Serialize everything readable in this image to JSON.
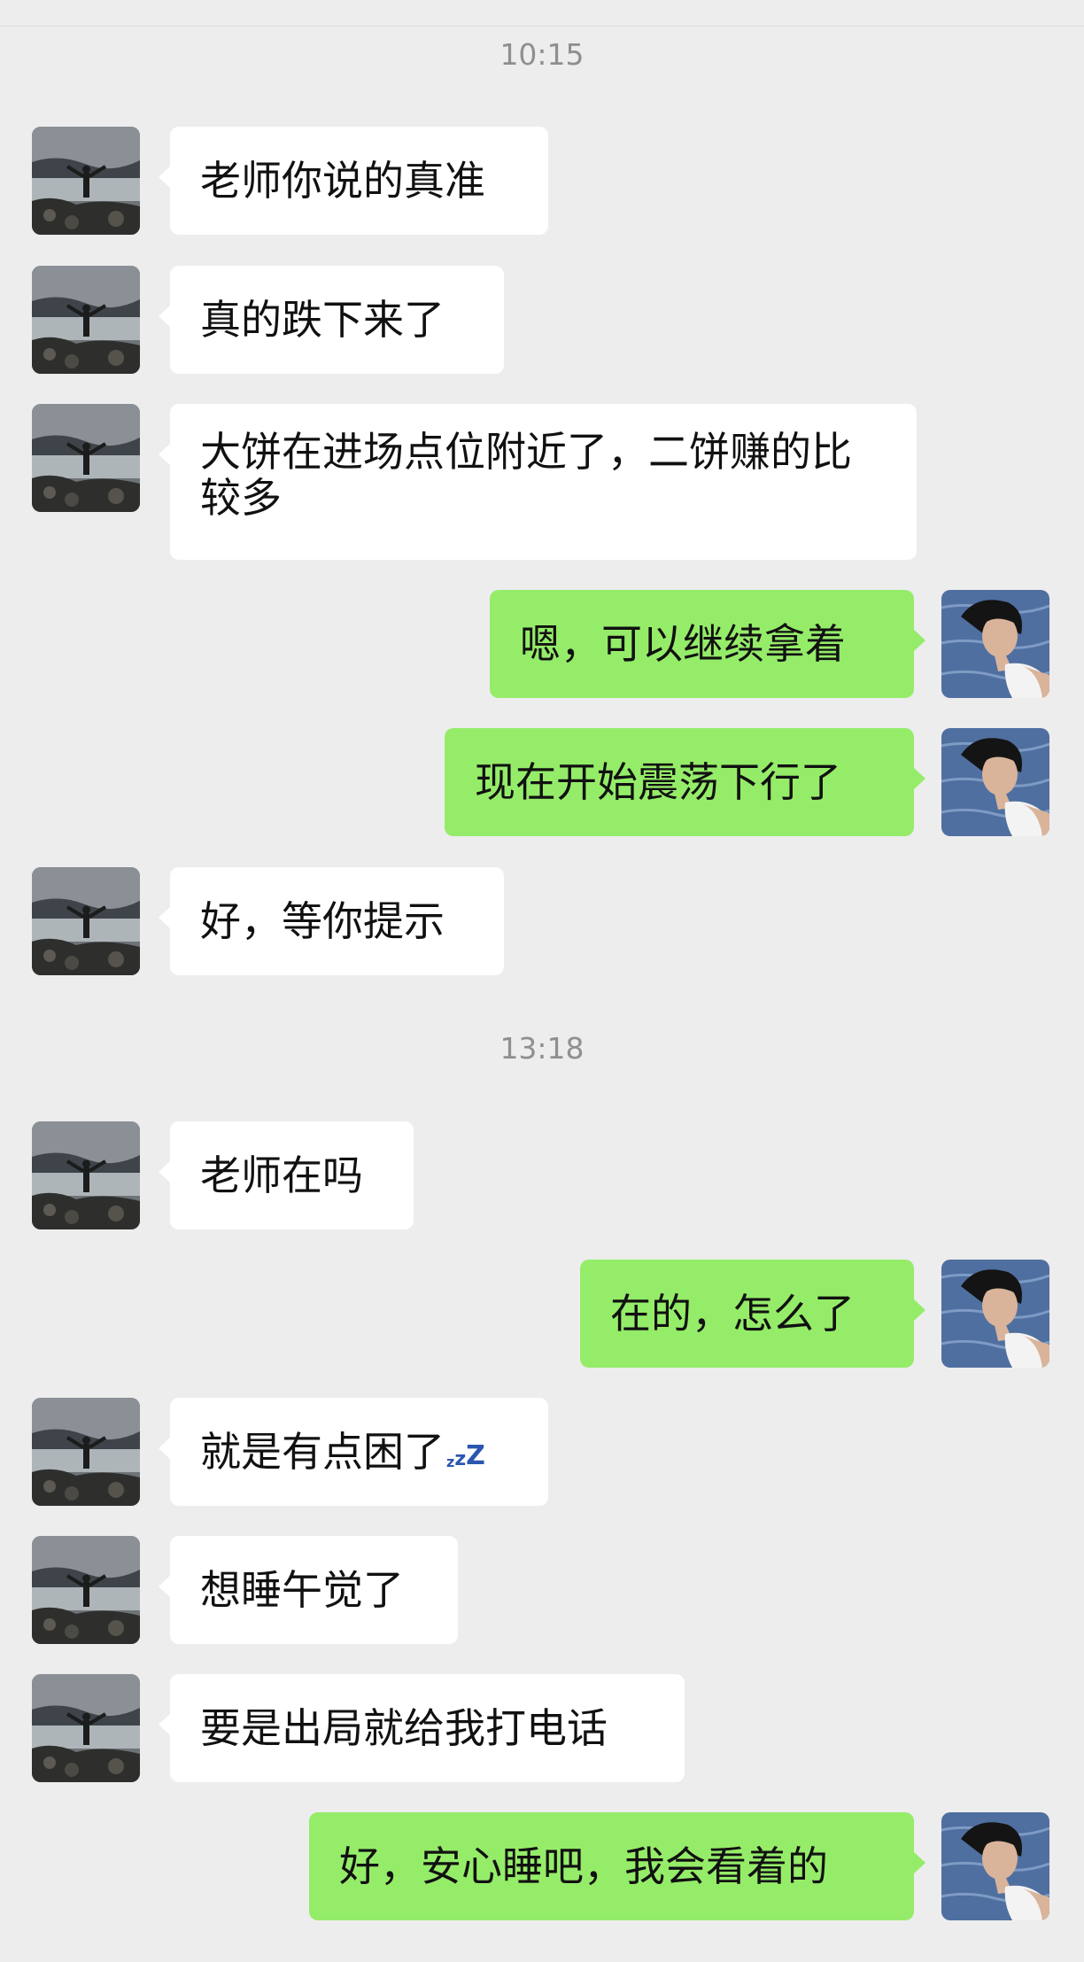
{
  "timestamps": [
    "10:15",
    "13:18"
  ],
  "messages": [
    {
      "side": "in",
      "text": "老师你说的真准"
    },
    {
      "side": "in",
      "text": "真的跌下来了"
    },
    {
      "side": "in",
      "text": "大饼在进场点位附近了，二饼赚的比较多"
    },
    {
      "side": "out",
      "text": "嗯，可以继续拿着"
    },
    {
      "side": "out",
      "text": "现在开始震荡下行了"
    },
    {
      "side": "in",
      "text": "好，等你提示"
    },
    {
      "side": "in",
      "text": "老师在吗"
    },
    {
      "side": "out",
      "text": "在的，怎么了"
    },
    {
      "side": "in",
      "text": "就是有点困了",
      "emoji": "sleeping-zzz"
    },
    {
      "side": "in",
      "text": "想睡午觉了"
    },
    {
      "side": "in",
      "text": "要是出局就给我打电话"
    },
    {
      "side": "out",
      "text": "好，安心睡吧，我会看着的"
    }
  ],
  "colors": {
    "background": "#ededed",
    "incoming_bubble": "#ffffff",
    "outgoing_bubble": "#95ec69",
    "timestamp_text": "#8f8f8f"
  }
}
